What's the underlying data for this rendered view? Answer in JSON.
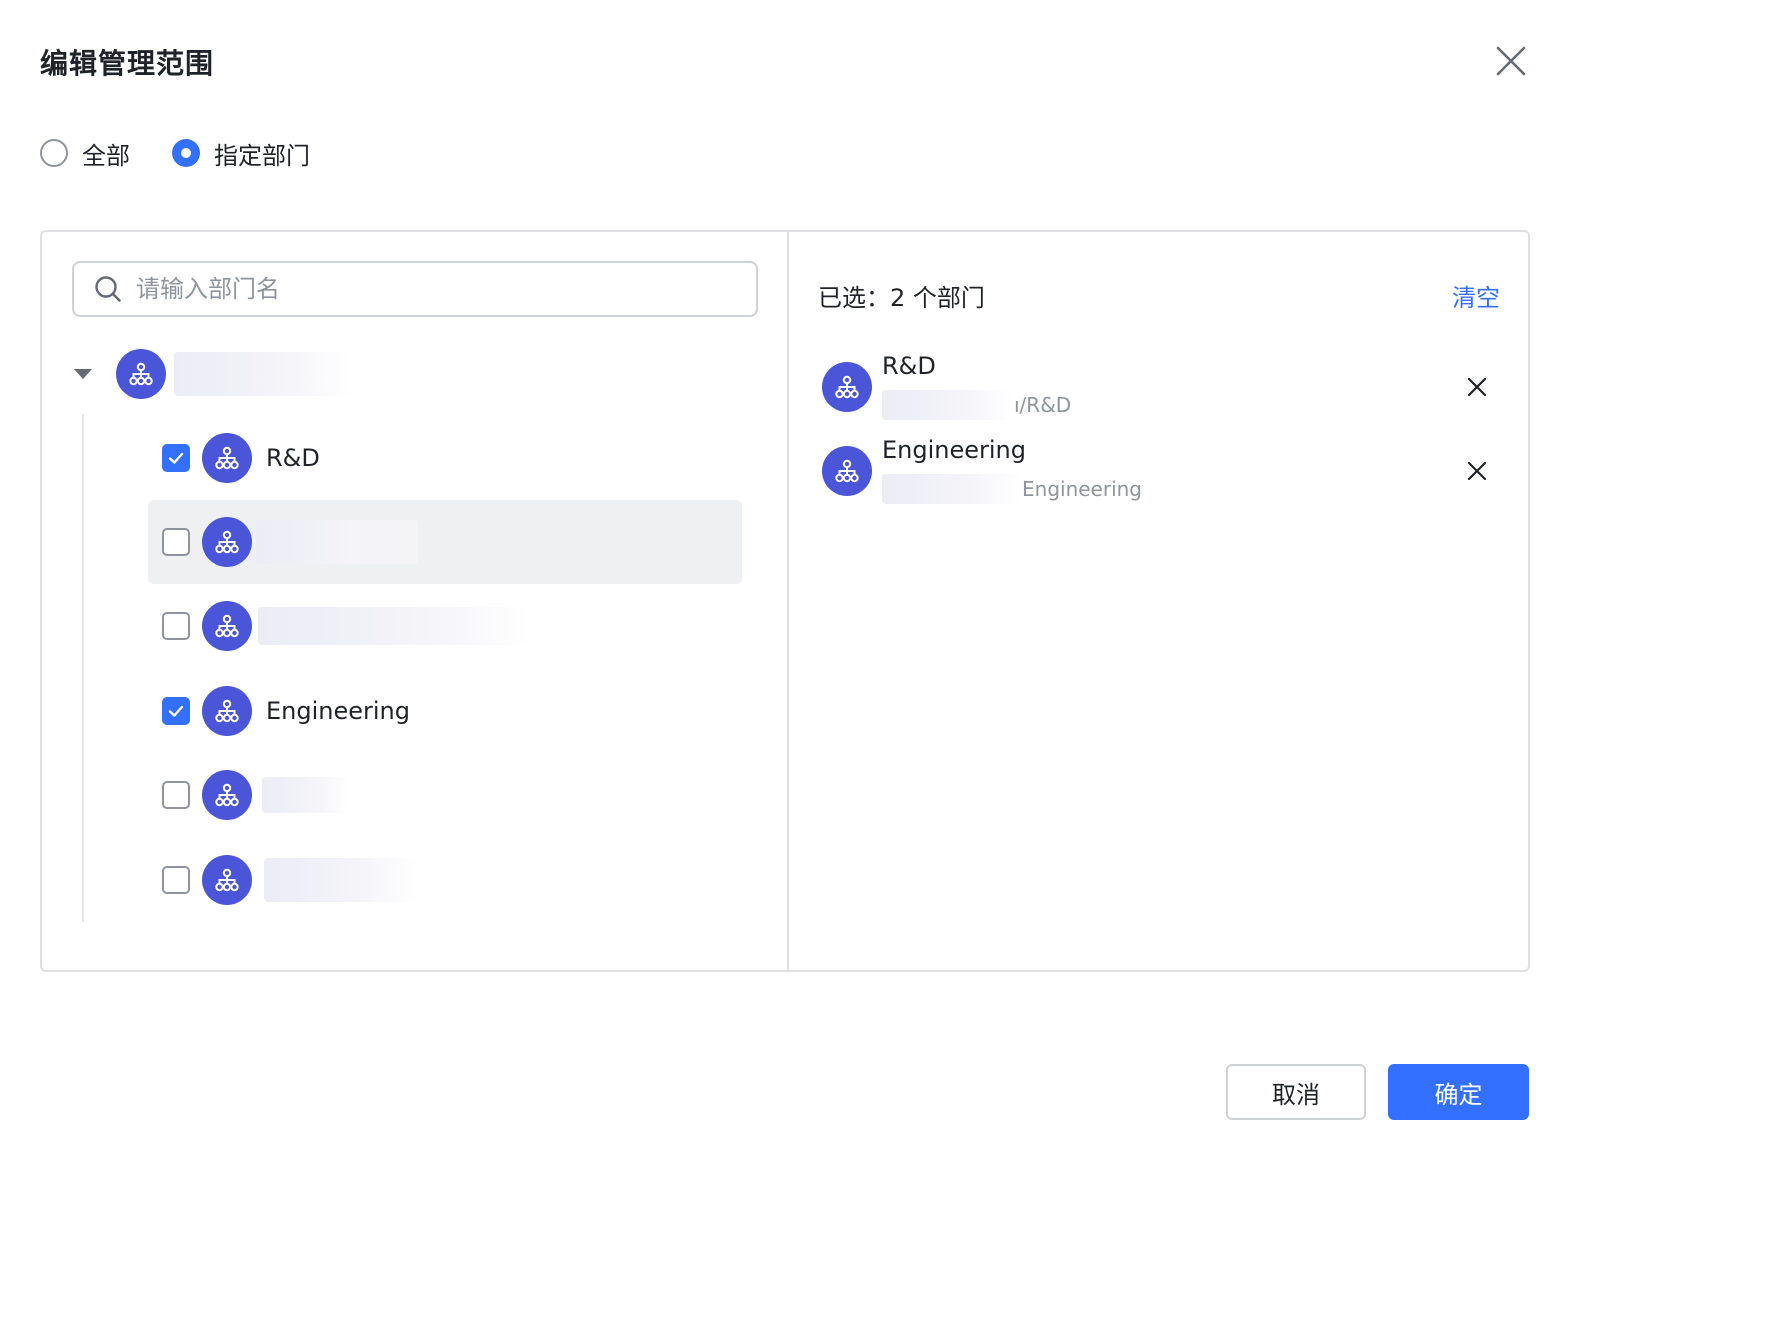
{
  "dialog": {
    "title": "编辑管理范围"
  },
  "scope": {
    "options": [
      {
        "label": "全部",
        "checked": false
      },
      {
        "label": "指定部门",
        "checked": true
      }
    ]
  },
  "search": {
    "placeholder": "请输入部门名"
  },
  "tree": {
    "root": {
      "label": "",
      "expanded": true
    },
    "children": [
      {
        "label": "R&D",
        "checked": true
      },
      {
        "label": "",
        "checked": false,
        "hovered": true
      },
      {
        "label": "",
        "checked": false
      },
      {
        "label": "Engineering",
        "checked": true
      },
      {
        "label": "",
        "checked": false
      },
      {
        "label": "",
        "checked": false
      }
    ]
  },
  "selected": {
    "header": "已选：2 个部门",
    "clear_label": "清空",
    "items": [
      {
        "name": "R&D",
        "path_suffix": "ı/R&D"
      },
      {
        "name": "Engineering",
        "path_suffix": "Engineering"
      }
    ]
  },
  "footer": {
    "cancel_label": "取消",
    "ok_label": "确定"
  },
  "colors": {
    "accent": "#3370ff",
    "avatar": "#4a55d8"
  },
  "icons": {
    "close": "close-icon",
    "search": "search-icon",
    "caret": "caret-down-icon",
    "department": "org-chart-icon",
    "check": "check-icon",
    "remove": "remove-icon"
  }
}
